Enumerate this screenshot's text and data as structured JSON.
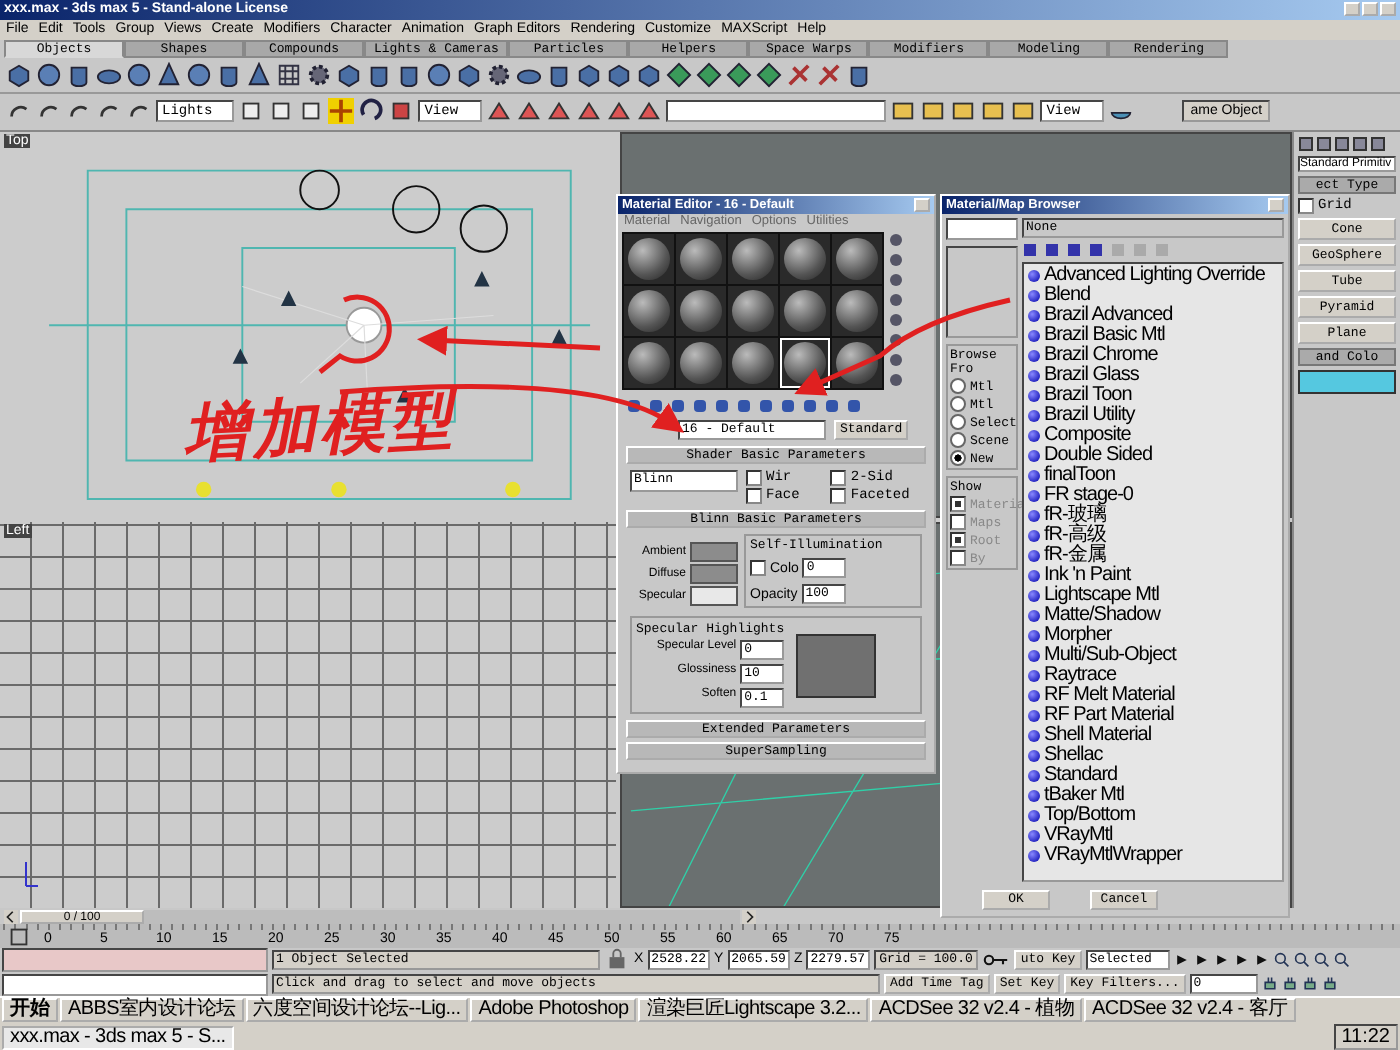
{
  "window": {
    "title": "xxx.max - 3ds max 5 - Stand-alone License"
  },
  "menu": [
    "File",
    "Edit",
    "Tools",
    "Group",
    "Views",
    "Create",
    "Modifiers",
    "Character",
    "Animation",
    "Graph Editors",
    "Rendering",
    "Customize",
    "MAXScript",
    "Help"
  ],
  "tabs": [
    {
      "label": "Objects",
      "selected": true
    },
    {
      "label": "Shapes",
      "selected": false
    },
    {
      "label": "Compounds",
      "selected": false
    },
    {
      "label": "Lights & Cameras",
      "selected": false
    },
    {
      "label": "Particles",
      "selected": false
    },
    {
      "label": "Helpers",
      "selected": false
    },
    {
      "label": "Space Warps",
      "selected": false
    },
    {
      "label": "Modifiers",
      "selected": false
    },
    {
      "label": "Modeling",
      "selected": false
    },
    {
      "label": "Rendering",
      "selected": false
    }
  ],
  "toolbar": {
    "selection_filter": "Lights",
    "reference_coords": "View",
    "view_dropdown": "View",
    "named_selection": "ame Object",
    "transform_tools": [
      {
        "selected": true
      },
      {
        "selected": false
      },
      {
        "selected": false
      }
    ]
  },
  "viewports": [
    {
      "label": "Top"
    },
    {
      "label": "Left"
    }
  ],
  "command_panel": {
    "category": "Standard Primitiv",
    "rollout": "ect Type",
    "autogrid": {
      "label": "Grid",
      "checked": false
    },
    "buttons": [
      "Cone",
      "GeoSphere",
      "Tube",
      "Pyramid",
      "Plane"
    ],
    "name_color": "and Colo",
    "color": "#55c8e0"
  },
  "annotation": "增加模型",
  "material_editor": {
    "title": "Material Editor - 16 - Default",
    "menu": [
      "Material",
      "Navigation",
      "Options",
      "Utilities"
    ],
    "slots": [
      {
        "selected": false
      },
      {
        "selected": false
      },
      {
        "selected": false
      },
      {
        "selected": false
      },
      {
        "selected": false
      },
      {
        "selected": false
      },
      {
        "selected": false
      },
      {
        "selected": false
      },
      {
        "selected": false
      },
      {
        "selected": false
      },
      {
        "selected": false
      },
      {
        "selected": false
      },
      {
        "selected": false
      },
      {
        "selected": true
      },
      {
        "selected": false
      }
    ],
    "material_name": "16 - Default",
    "type": "Standard",
    "shader": {
      "header": "Shader Basic Parameters",
      "shader": "Blinn",
      "options": [
        {
          "label": "Wir",
          "checked": false
        },
        {
          "label": "2-Sid",
          "checked": false
        },
        {
          "label": "Face",
          "checked": false
        },
        {
          "label": "Faceted",
          "checked": false
        }
      ]
    },
    "blinn": {
      "header": "Blinn Basic Parameters",
      "colors": [
        {
          "label": "Ambient",
          "color": "#8c8c8c"
        },
        {
          "label": "Diffuse",
          "color": "#8c8c8c"
        },
        {
          "label": "Specular",
          "color": "#e8e8e8"
        }
      ],
      "self_illum": {
        "title": "Self-Illumination",
        "label": "Colo",
        "checked": false,
        "value": "0"
      },
      "opacity": {
        "label": "Opacity",
        "value": "100"
      },
      "highlights": {
        "title": "Specular Highlights",
        "fields": [
          {
            "label": "Specular Level",
            "value": "0"
          },
          {
            "label": "Glossiness",
            "value": "10"
          },
          {
            "label": "Soften",
            "value": "0.1"
          }
        ]
      }
    },
    "collapsed": [
      "Extended Parameters",
      "SuperSampling"
    ]
  },
  "browser": {
    "title": "Material/Map Browser",
    "name_field": "None",
    "browse_from": {
      "title": "Browse Fro",
      "options": [
        {
          "label": "Mtl",
          "selected": false
        },
        {
          "label": "Mtl",
          "selected": false
        },
        {
          "label": "Select",
          "selected": false
        },
        {
          "label": "Scene",
          "selected": false
        },
        {
          "label": "New",
          "selected": true
        }
      ]
    },
    "show": {
      "title": "Show",
      "options": [
        {
          "label": "Materia",
          "checked": true
        },
        {
          "label": "Maps",
          "checked": false
        },
        {
          "label": "Root",
          "checked": true
        },
        {
          "label": "By",
          "checked": false
        }
      ]
    },
    "items": [
      "Advanced Lighting Override",
      "Blend",
      "Brazil Advanced",
      "Brazil Basic Mtl",
      "Brazil Chrome",
      "Brazil Glass",
      "Brazil Toon",
      "Brazil Utility",
      "Composite",
      "Double Sided",
      "finalToon",
      "FR stage-0",
      "fR-玻璃",
      "fR-高级",
      "fR-金属",
      "Ink 'n Paint",
      "Lightscape Mtl",
      "Matte/Shadow",
      "Morpher",
      "Multi/Sub-Object",
      "Raytrace",
      "RF Melt Material",
      "RF Part Material",
      "Shell Material",
      "Shellac",
      "Standard",
      "tBaker Mtl",
      "Top/Bottom",
      "VRayMtl",
      "VRayMtlWrapper"
    ],
    "buttons": [
      "OK",
      "Cancel"
    ]
  },
  "timeline": {
    "position": "0 / 100",
    "level": 0,
    "ticks": [
      "0",
      "5",
      "10",
      "15",
      "20",
      "25",
      "30",
      "35",
      "40",
      "45",
      "50",
      "55",
      "60",
      "65",
      "70",
      "75"
    ]
  },
  "status": {
    "selection": "1 Object Selected",
    "prompt": "Click and drag to select and move objects",
    "coords": [
      {
        "axis": "X",
        "value": "2528.22"
      },
      {
        "axis": "Y",
        "value": "2065.59"
      },
      {
        "axis": "Z",
        "value": "2279.57"
      }
    ],
    "grid": "Grid = 100.0",
    "add_time_tag": "Add Time Tag",
    "auto_key": "uto Key",
    "key_mode": "Selected",
    "set_key": "Set Key",
    "key_filters": "Key Filters...",
    "frame": "0"
  },
  "taskbar": {
    "start": "开始",
    "tasks": [
      {
        "label": "ABBS室内设计论坛",
        "selected": false
      },
      {
        "label": "六度空间设计论坛--Lig...",
        "selected": false
      },
      {
        "label": "Adobe Photoshop",
        "selected": false
      },
      {
        "label": "渲染巨匠Lightscape 3.2...",
        "selected": false
      },
      {
        "label": "ACDSee 32 v2.4 - 植物",
        "selected": false
      },
      {
        "label": "ACDSee 32 v2.4 - 客厅",
        "selected": false
      },
      {
        "label": "xxx.max - 3ds max 5 - S...",
        "selected": true
      }
    ],
    "clock": "11:22"
  }
}
